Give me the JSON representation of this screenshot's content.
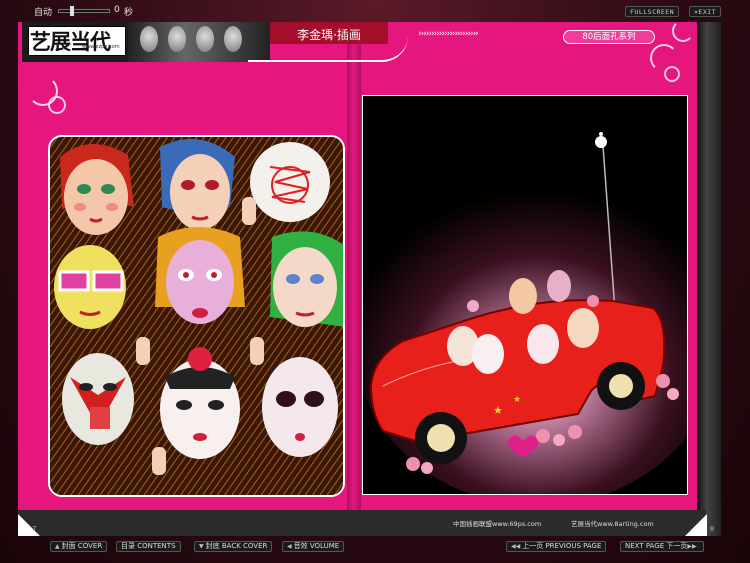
{
  "top": {
    "auto_label": "自动",
    "seconds_value": "0",
    "seconds_label": "秒",
    "fullscreen_label": "FULLSCREEN",
    "exit_label": "EXIT"
  },
  "header": {
    "logo_text": "艺展当代",
    "logo_url": "www.ezpe.com",
    "title": "李金瑀·插画",
    "decor_arrows": "›››››››››››››››››››››››",
    "series_tag": "80后面孔系列"
  },
  "footer": {
    "text_left": "中国插画联盟www.69ps.com",
    "text_right": "艺展当代www.8arting.com",
    "page_left": "7",
    "page_right": "8"
  },
  "nav": {
    "front_cover": "封面 COVER",
    "contents": "目录 CONTENTS",
    "back_cover": "封底 BACK COVER",
    "sound": "音效 VOLUME",
    "prev_page": "上一页 PREVIOUS PAGE",
    "next_page": "NEXT PAGE 下一页"
  },
  "colors": {
    "page_pink": "#e5177f",
    "header_red": "#a50e2a",
    "car_red": "#e8201c"
  },
  "icons": {
    "prev": "double-left-arrow-icon",
    "next": "double-right-arrow-icon",
    "sound": "speaker-icon"
  }
}
